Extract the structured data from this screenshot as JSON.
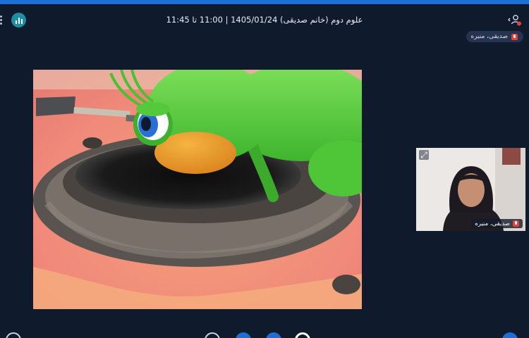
{
  "header": {
    "title": "علوم دوم (خانم صدیقی) 1405/01/24 | 11:00 تا 11:45"
  },
  "presenter": {
    "name": "صدیقی، منیره"
  },
  "webcam": {
    "name": "صدیقی، منیره"
  },
  "icons": {
    "menu": "vertical-dots-icon",
    "stats": "bar-chart-icon",
    "user": "user-status-icon",
    "mic": "mic-muted-icon",
    "expand": "expand-icon"
  },
  "colors": {
    "background": "#0f1a2c",
    "accent": "#1d6fd8",
    "stats_button": "#1f8ea0",
    "mute_badge": "#e0413a"
  }
}
